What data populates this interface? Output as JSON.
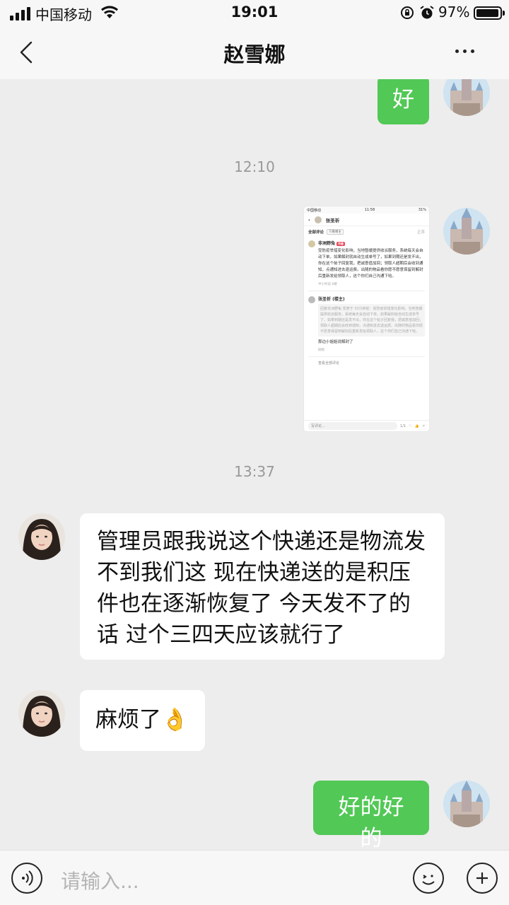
{
  "status_bar": {
    "carrier": "中国移动",
    "time": "19:01",
    "battery": "97%"
  },
  "nav": {
    "title": "赵雪娜"
  },
  "messages": {
    "m1": "好",
    "ts1": "12:10",
    "ts2": "13:37",
    "m3": "管理员跟我说这个快递还是物流发不到我们这 现在快递送的是积压件也在逐渐恢复了 今天发不了的话 过个三四天应该就行了",
    "m4": "麻烦了👌",
    "m5": "好的好的"
  },
  "thumbnail": {
    "status_carrier": "中国移动",
    "status_time": "11:58",
    "status_battery": "31%",
    "nav_name": "张圣祈",
    "tab_all": "全部评论",
    "tab_tag": "只看楼主",
    "tab_right": "正序",
    "c1_name": "非洲野兔",
    "c1_badge": "作者",
    "c1_text": "受防疫举措变化影响，当地暂缓提供收派服务，系统每天会自动下单，如果解封就自动生成单号了，如果到期还是发不出，你在这个帖子回复我，把诚意值加回；领取人超期后会收到通知，点通知进去退运费。出随的物品看你愿不愿意保留到解封后重新发给领取人，这个你们自己沟通下哈。",
    "c1_meta": "半小时前 8楼",
    "c2_name": "张圣祈 (楼主)",
    "c2_quote": "回复非洲野兔 发表于 33分钟前：受防疫举措变化影响，当地暂缓提供收派服务，系统每天会自动下单，如果解封就自动生成单号了，如果到期还是发不出，你在这个帖子回复我，把诚意值加回；领取人超期后会收到通知，点通知进去退运费。出随的物品看你愿不愿意保留到解封后重新发给领取人，这个你们自己沟通下哈。",
    "c2_text": "那边小姐姐说解封了",
    "c2_meta": "刚刚",
    "view_all": "查看全部评论",
    "input_placeholder": "写评论...",
    "page": "1/1"
  },
  "input": {
    "placeholder": "请输入..."
  },
  "colors": {
    "my_bubble": "#52c856",
    "background": "#ededed"
  }
}
